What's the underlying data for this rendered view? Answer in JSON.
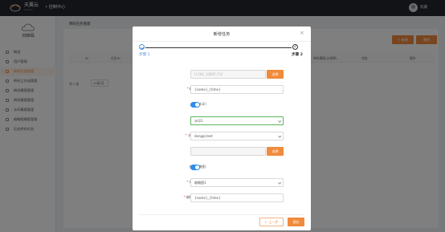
{
  "topbar": {
    "brand": "天翼云",
    "brand_sub": "e Cloud",
    "console": "• 控制中心",
    "user_name": "玩家"
  },
  "sidebar": {
    "title": "日转码",
    "items": [
      {
        "label": "概述",
        "active": false
      },
      {
        "label": "用户管理",
        "active": false
      },
      {
        "label": "转码任务管理",
        "active": true
      },
      {
        "label": "转码工作流管理",
        "active": false
      },
      {
        "label": "转码模版管理",
        "active": false
      },
      {
        "label": "转码模版管理",
        "active": false
      },
      {
        "label": "水印模版管理",
        "active": false
      },
      {
        "label": "缩略图模版管理",
        "active": false
      },
      {
        "label": "历史转码任务",
        "active": false
      }
    ]
  },
  "main": {
    "page_title": "转码任务管理",
    "new_button": "+ 新增",
    "delete_button": "删除",
    "columns": [
      "ID",
      "任务ID",
      "",
      "",
      "任务名称",
      "转码模版(分辨率)",
      "状态",
      "操作"
    ],
    "pager_total": "共 0 条",
    "pager_size": "10条/页"
  },
  "modal": {
    "title": "新增任务",
    "close": "×",
    "step1_label": "步骤 1",
    "step2_label": "步骤 2",
    "step2_number": "2",
    "fields": {
      "transcode_template": {
        "label": "转码模板:",
        "placeholder": "H.264_1080P_FLV",
        "button": "选择"
      },
      "output_filename": {
        "label": "输出文件名:",
        "value": "{name}_{time}"
      },
      "use_watermark": {
        "label": "使用水印:",
        "on": true
      },
      "watermark_template": {
        "label": "水印模板:",
        "value": "水印1"
      },
      "watermark_bucket": {
        "label": "水印Bucket:",
        "value": "dongqi.test"
      },
      "watermark_file": {
        "label": "水印文件:",
        "value": "",
        "button": "选择"
      },
      "use_thumbnail": {
        "label": "使用缩略图:",
        "on": true
      },
      "thumbnail_template": {
        "label": "缩略图模板:",
        "value": "缩略图1"
      },
      "thumbnail_filename": {
        "label": "缩略图文件名:",
        "value": "{name}_{time}"
      }
    },
    "prev_button": "← 上一步",
    "save_button": "保存"
  },
  "colors": {
    "accent": "#f08a3c",
    "step_active": "#4a90e2",
    "toggle_on": "#2d8cf0",
    "topbar_bg": "#23262e"
  }
}
